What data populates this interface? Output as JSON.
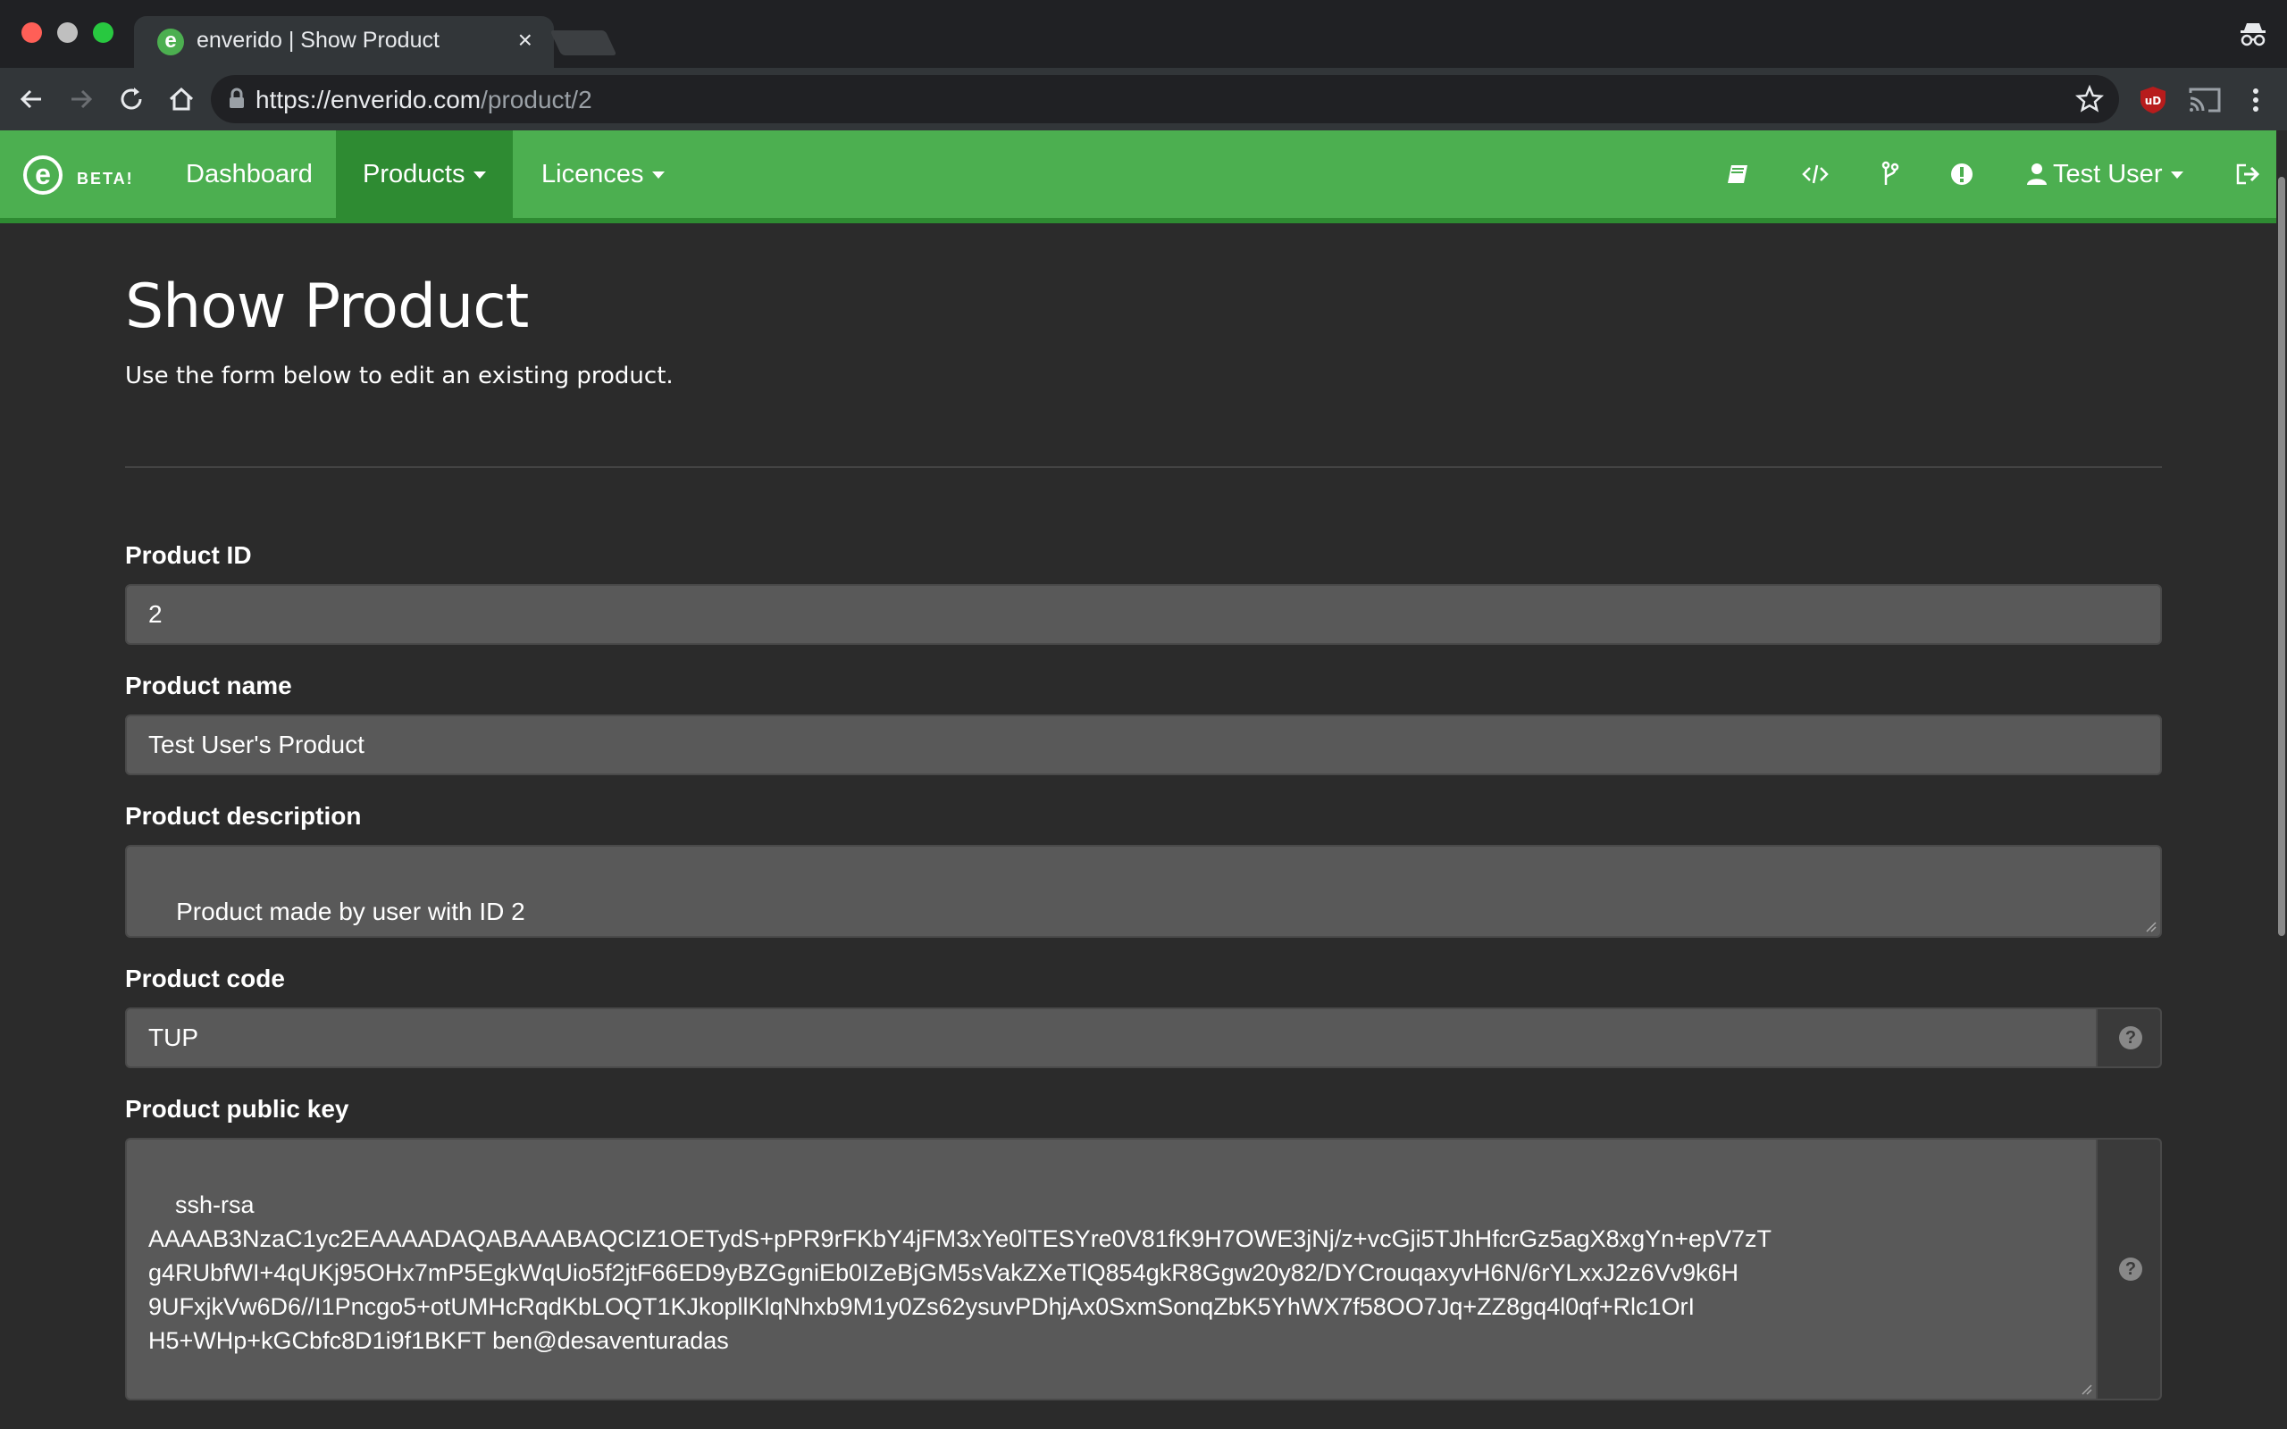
{
  "browser": {
    "tab_title": "enverido | Show Product",
    "tab_favicon_letter": "e",
    "url_host": "https://enverido.com",
    "url_path": "/product/2"
  },
  "navbar": {
    "brand_letter": "e",
    "beta_label": "BETA!",
    "items": [
      {
        "label": "Dashboard"
      },
      {
        "label": "Products"
      },
      {
        "label": "Licences"
      }
    ],
    "user_label": "Test User",
    "colors": {
      "bar": "#4caf50",
      "active": "#2e8b32"
    }
  },
  "page": {
    "title": "Show Product",
    "subtitle": "Use the form below to edit an existing product."
  },
  "form": {
    "product_id": {
      "label": "Product ID",
      "value": "2"
    },
    "product_name": {
      "label": "Product name",
      "value": "Test User's Product"
    },
    "product_description": {
      "label": "Product description",
      "value": "Product made by user with ID 2"
    },
    "product_code": {
      "label": "Product code",
      "value": "TUP",
      "help_icon": "question-circle-icon"
    },
    "product_public_key": {
      "label": "Product public key",
      "value": "ssh-rsa\nAAAAB3NzaC1yc2EAAAADAQABAAABAQCIZ1OETydS+pPR9rFKbY4jFM3xYe0lTESYre0V81fK9H7OWE3jNj/z+vcGji5TJhHfcrGz5agX8xgYn+epV7zT\ng4RUbfWI+4qUKj95OHx7mP5EgkWqUio5f2jtF66ED9yBZGgniEb0IZeBjGM5sVakZXeTlQ854gkR8Ggw20y82/DYCrouqaxyvH6N/6rYLxxJ2z6Vv9k6H\n9UFxjkVw6D6//I1Pncgo5+otUMHcRqdKbLOQT1KJkopllKlqNhxb9M1y0Zs62ysuvPDhjAx0SxmSonqZbK5YhWX7f58OO7Jq+ZZ8gq4l0qf+Rlc1OrI\nH5+WHp+kGCbfc8D1i9f1BKFT ben@desaventuradas",
      "help_icon": "question-circle-icon"
    }
  }
}
